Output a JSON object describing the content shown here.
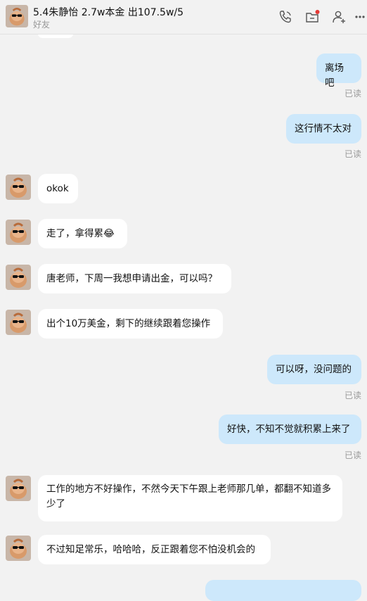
{
  "header": {
    "title": "5.4朱静怡 2.7w本金 出107.5w/5",
    "subtitle": "好友",
    "icons": [
      "phone-icon",
      "folder-icon",
      "add-friend-icon",
      "more-icon"
    ]
  },
  "colors": {
    "outgoing_bubble": "#cde8fb",
    "incoming_bubble": "#ffffff",
    "background": "#f2f2f2",
    "notification_dot": "#e53935"
  },
  "messages": [
    {
      "direction": "out",
      "text": "离场吧",
      "status": "已读"
    },
    {
      "direction": "out",
      "text": "这行情不太对",
      "status": "已读"
    },
    {
      "direction": "in",
      "text": "okok"
    },
    {
      "direction": "in",
      "text": "走了，拿得累😂"
    },
    {
      "direction": "in",
      "text": "唐老师，下周一我想申请出金，可以吗？"
    },
    {
      "direction": "in",
      "text": "出个10万美金，剩下的继续跟着您操作"
    },
    {
      "direction": "out",
      "text": "可以呀，没问题的",
      "status": "已读"
    },
    {
      "direction": "out",
      "text": "好快，不知不觉就积累上来了",
      "status": "已读"
    },
    {
      "direction": "in",
      "text": "工作的地方不好操作，不然今天下午跟上老师那几单，都翻不知道多少了"
    },
    {
      "direction": "in",
      "text": "不过知足常乐，哈哈哈，反正跟着您不怕没机会的"
    }
  ]
}
